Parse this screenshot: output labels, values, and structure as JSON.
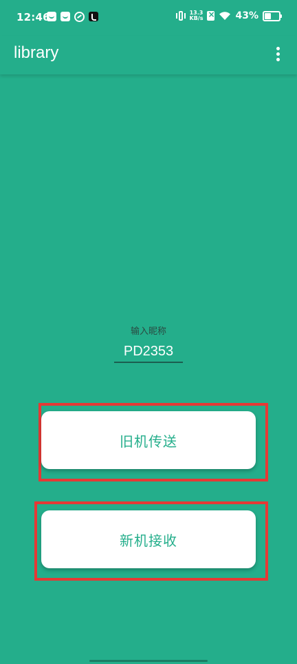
{
  "status_bar": {
    "time": "12:46",
    "net_speed_value": "13.3",
    "net_speed_unit": "KB/s",
    "battery": "43%",
    "battery_level": 0.43,
    "left_icons": [
      "app-notification-icon",
      "mail-icon",
      "sync-icon",
      "tiktok-icon"
    ],
    "right_icons": [
      "vibrate-icon",
      "no-sim-icon",
      "wifi-icon",
      "battery-icon"
    ]
  },
  "app_bar": {
    "title": "library",
    "menu_icon": "more-vert-icon"
  },
  "nickname": {
    "label": "输入昵称",
    "value": "PD2353"
  },
  "buttons": {
    "old_device_send": "旧机传送",
    "new_device_receive": "新机接收"
  },
  "colors": {
    "background": "#24AE8B",
    "button_text": "#24AE8B",
    "highlight": "#E53935"
  }
}
